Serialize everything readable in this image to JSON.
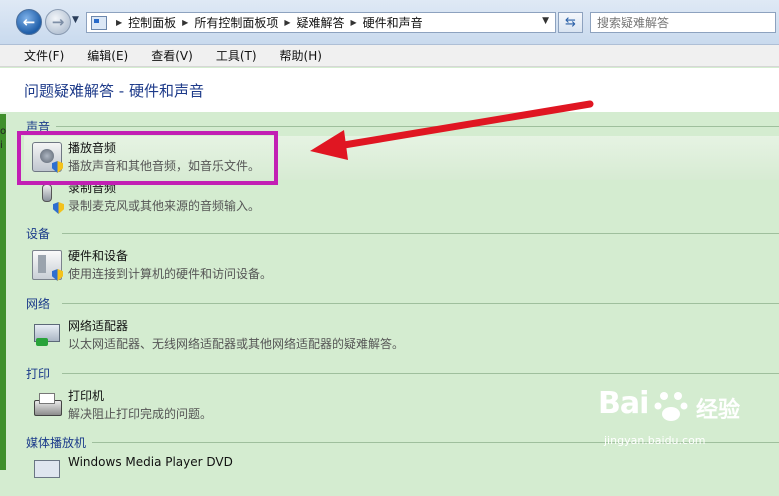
{
  "address": {
    "breadcrumbs": [
      "控制面板",
      "所有控制面板项",
      "疑难解答",
      "硬件和声音"
    ],
    "search_placeholder": "搜索疑难解答"
  },
  "menu": [
    "文件(F)",
    "编辑(E)",
    "查看(V)",
    "工具(T)",
    "帮助(H)"
  ],
  "page_title": "问题疑难解答 - 硬件和声音",
  "categories": [
    {
      "name": "声音",
      "items": [
        {
          "title": "播放音频",
          "desc": "播放声音和其他音频，如音乐文件。",
          "icon": "speaker-icon"
        },
        {
          "title": "录制音频",
          "desc": "录制麦克风或其他来源的音频输入。",
          "icon": "microphone-icon"
        }
      ]
    },
    {
      "name": "设备",
      "items": [
        {
          "title": "硬件和设备",
          "desc": "使用连接到计算机的硬件和访问设备。",
          "icon": "hardware-icon"
        }
      ]
    },
    {
      "name": "网络",
      "items": [
        {
          "title": "网络适配器",
          "desc": "以太网适配器、无线网络适配器或其他网络适配器的疑难解答。",
          "icon": "network-adapter-icon"
        }
      ]
    },
    {
      "name": "打印",
      "items": [
        {
          "title": "打印机",
          "desc": "解决阻止打印完成的问题。",
          "icon": "printer-icon"
        }
      ]
    },
    {
      "name": "媒体播放机",
      "items": [
        {
          "title": "Windows Media Player DVD",
          "desc": "",
          "icon": "dvd-icon"
        }
      ]
    }
  ],
  "left_edge_text": "o\ni",
  "watermark": {
    "brand": "Bai",
    "cn": "经验",
    "url": "jingyan.baidu.com"
  },
  "colors": {
    "highlight_box": "#c21fb4",
    "arrow": "#e01622",
    "content_bg": "#d4ecd0",
    "title": "#1e3b8a"
  }
}
